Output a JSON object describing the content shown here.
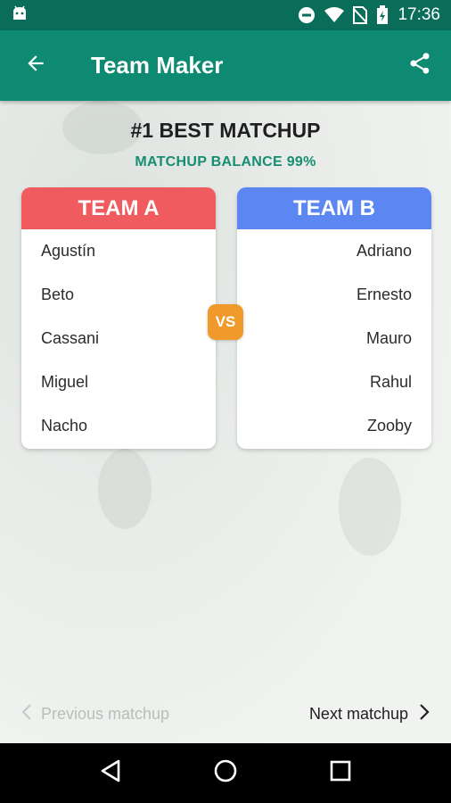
{
  "status_bar": {
    "time": "17:36"
  },
  "app_bar": {
    "title": "Team Maker"
  },
  "matchup": {
    "title": "#1 BEST MATCHUP",
    "balance": "MATCHUP BALANCE 99%",
    "vs_label": "VS"
  },
  "team_a": {
    "name": "TEAM A",
    "color": "#f05b60",
    "players": [
      "Agustín",
      "Beto",
      "Cassani",
      "Miguel",
      "Nacho"
    ]
  },
  "team_b": {
    "name": "TEAM B",
    "color": "#5c86f2",
    "players": [
      "Adriano",
      "Ernesto",
      "Mauro",
      "Rahul",
      "Zooby"
    ]
  },
  "navigation": {
    "prev_label": "Previous matchup",
    "next_label": "Next matchup"
  },
  "colors": {
    "primary": "#0e8a72",
    "primary_dark": "#0a6d59",
    "accent": "#178e72",
    "vs": "#ef9a2a"
  },
  "icons": [
    "android-icon",
    "dnd-icon",
    "wifi-icon",
    "no-sim-icon",
    "battery-icon",
    "back-arrow-icon",
    "share-icon",
    "chevron-left-icon",
    "chevron-right-icon",
    "nav-back-icon",
    "nav-home-icon",
    "nav-recents-icon"
  ]
}
